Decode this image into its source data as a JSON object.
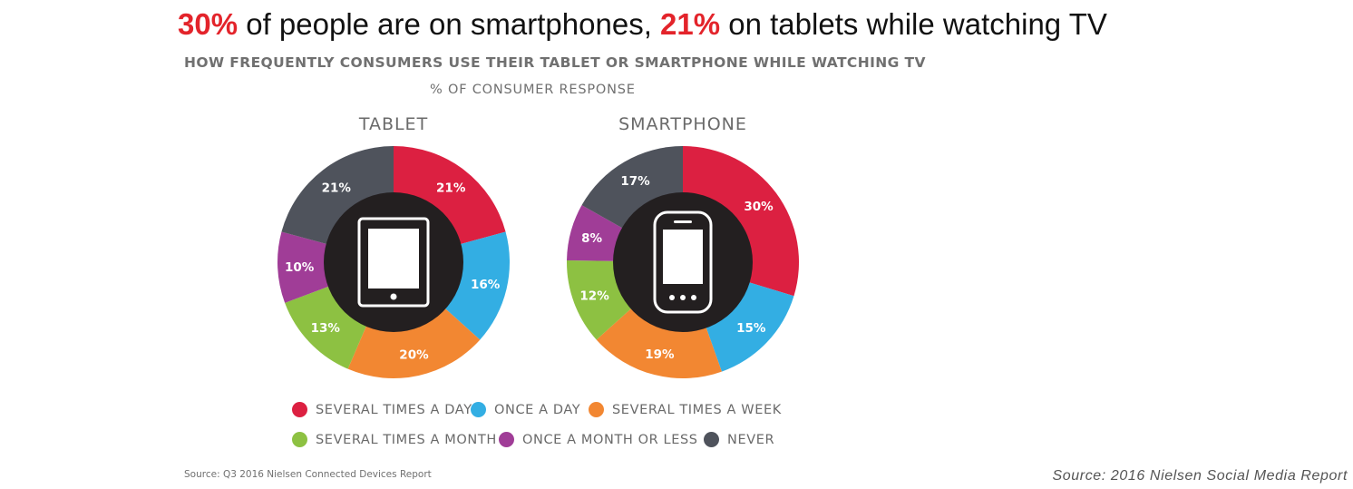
{
  "headline": {
    "pct1": "30%",
    "text1": " of people are on smartphones, ",
    "pct2": "21%",
    "text2": " on tablets while watching TV"
  },
  "subtitle": "HOW FREQUENTLY CONSUMERS USE THEIR TABLET OR SMARTPHONE WHILE WATCHING TV",
  "caption": "% OF CONSUMER RESPONSE",
  "colors": {
    "several_day": "#dc2041",
    "once_day": "#33aee3",
    "several_week": "#f28732",
    "several_month": "#8dc142",
    "once_month_less": "#a03d97",
    "never": "#4f535c",
    "center": "#231f20"
  },
  "icons": [
    "tablet-icon",
    "smartphone-icon"
  ],
  "legend": [
    {
      "label": "SEVERAL TIMES A DAY",
      "color": "#dc2041"
    },
    {
      "label": "ONCE A DAY",
      "color": "#33aee3"
    },
    {
      "label": "SEVERAL TIMES A WEEK",
      "color": "#f28732"
    },
    {
      "label": "SEVERAL TIMES A MONTH",
      "color": "#8dc142"
    },
    {
      "label": "ONCE A MONTH OR LESS",
      "color": "#a03d97"
    },
    {
      "label": "NEVER",
      "color": "#4f535c"
    }
  ],
  "chart_data": [
    {
      "type": "pie",
      "title": "TABLET",
      "categories": [
        "SEVERAL TIMES A DAY",
        "ONCE A DAY",
        "SEVERAL TIMES A WEEK",
        "SEVERAL TIMES A MONTH",
        "ONCE A MONTH OR LESS",
        "NEVER"
      ],
      "values": [
        21,
        16,
        20,
        13,
        10,
        21
      ],
      "labels": [
        "21%",
        "16%",
        "20%",
        "13%",
        "10%",
        "21%"
      ],
      "colors": [
        "#dc2041",
        "#33aee3",
        "#f28732",
        "#8dc142",
        "#a03d97",
        "#4f535c"
      ],
      "legend": "bottom"
    },
    {
      "type": "pie",
      "title": "SMARTPHONE",
      "categories": [
        "SEVERAL TIMES A DAY",
        "ONCE A DAY",
        "SEVERAL TIMES A WEEK",
        "SEVERAL TIMES A MONTH",
        "ONCE A MONTH OR LESS",
        "NEVER"
      ],
      "values": [
        30,
        15,
        19,
        12,
        8,
        17
      ],
      "labels": [
        "30%",
        "15%",
        "19%",
        "12%",
        "8%",
        "17%"
      ],
      "colors": [
        "#dc2041",
        "#33aee3",
        "#f28732",
        "#8dc142",
        "#a03d97",
        "#4f535c"
      ],
      "legend": "bottom"
    }
  ],
  "sources": {
    "left": "Source: Q3 2016 Nielsen Connected Devices Report",
    "right": "Source:  2016  Nielsen  Social  Media  Report"
  }
}
